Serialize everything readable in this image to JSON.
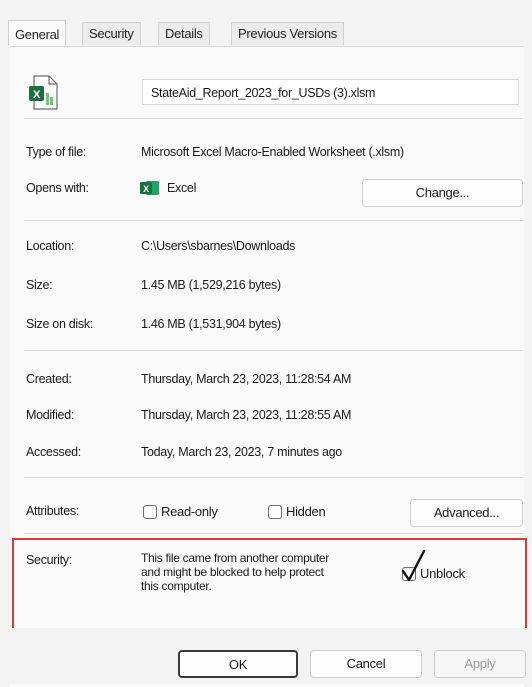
{
  "tabs": [
    "General",
    "Security",
    "Details",
    "Previous Versions"
  ],
  "file": {
    "name": "StateAid_Report_2023_for_USDs (3).xlsm",
    "icon": "excel-file-icon"
  },
  "rows": {
    "type_label": "Type of file:",
    "type_value": "Microsoft Excel Macro-Enabled Worksheet (.xlsm)",
    "opens_label": "Opens with:",
    "opens_value": "Excel",
    "change_label": "Change...",
    "location_label": "Location:",
    "location_value": "C:\\Users\\sbarnes\\Downloads",
    "size_label": "Size:",
    "size_value": "1.45 MB (1,529,216 bytes)",
    "sizedisk_label": "Size on disk:",
    "sizedisk_value": "1.46 MB (1,531,904 bytes)",
    "created_label": "Created:",
    "created_value": "Thursday, March 23, 2023, 11:28:54 AM",
    "modified_label": "Modified:",
    "modified_value": "Thursday, March 23, 2023, 11:28:55 AM",
    "accessed_label": "Accessed:",
    "accessed_value": "Today, March 23, 2023, 7 minutes ago",
    "attributes_label": "Attributes:",
    "readonly_label": "Read-only",
    "hidden_label": "Hidden",
    "advanced_label": "Advanced...",
    "security_label": "Security:",
    "security_line1": "This file came from another computer",
    "security_line2": "and might be blocked to help protect",
    "security_line3": "this computer.",
    "unblock_label": "Unblock"
  },
  "buttons": {
    "ok": "OK",
    "cancel": "Cancel",
    "apply": "Apply"
  },
  "colors": {
    "excel_green": "#1d6f42",
    "highlight_red": "#d83b3b"
  }
}
